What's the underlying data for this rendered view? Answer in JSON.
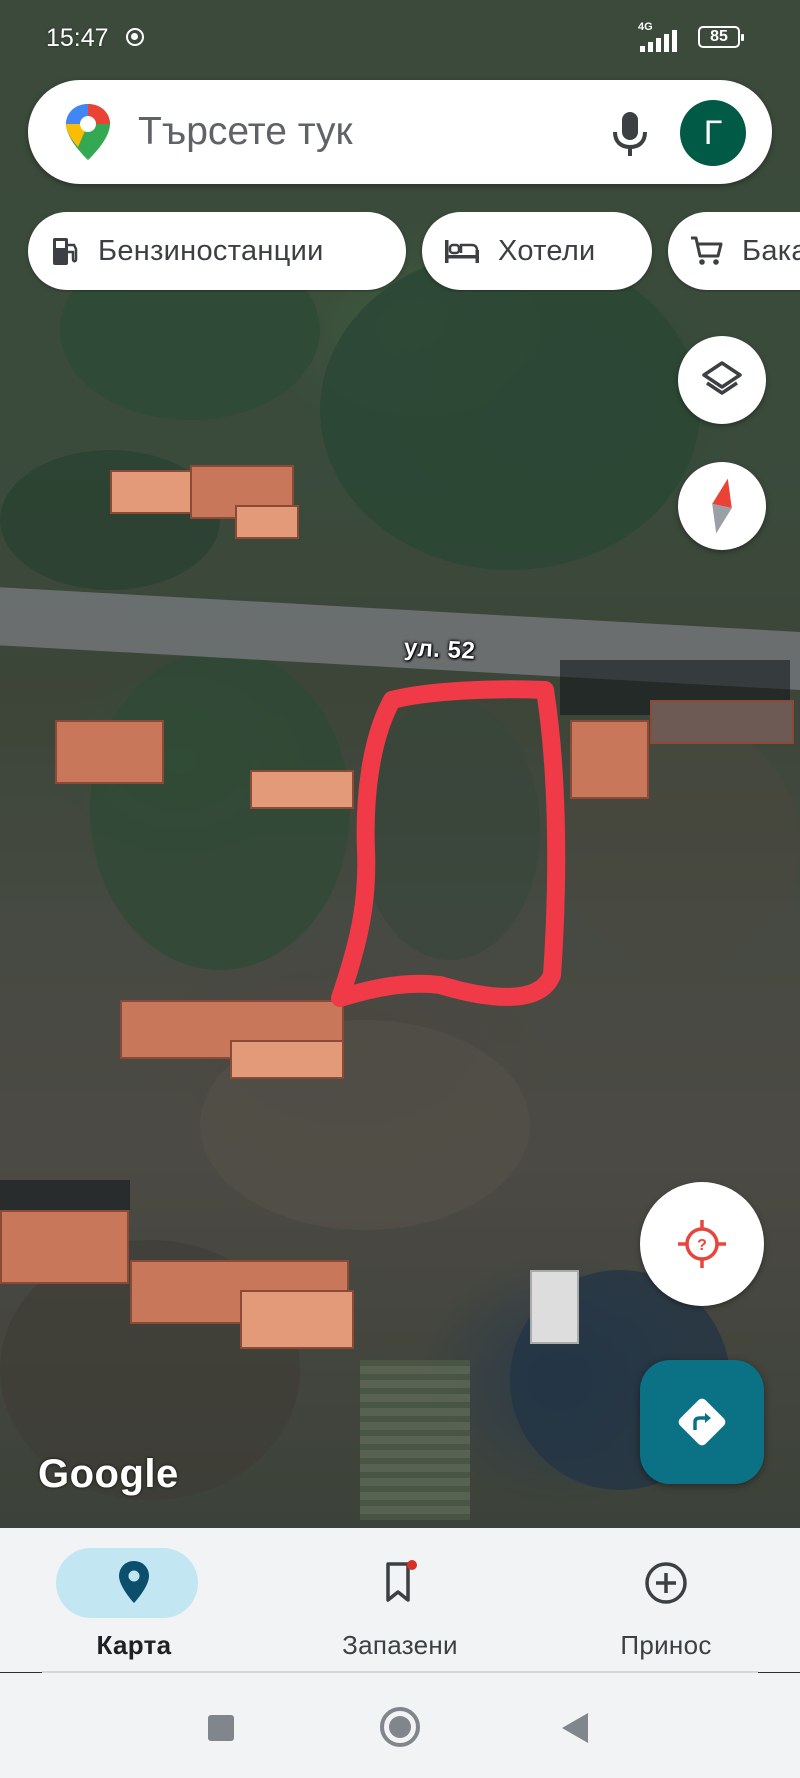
{
  "status_bar": {
    "time": "15:47",
    "network": "4G",
    "battery": "85"
  },
  "search": {
    "placeholder": "Търсете тук",
    "avatar_letter": "Г"
  },
  "chips": [
    {
      "label": "Бензиностанции",
      "icon": "gas-station-icon"
    },
    {
      "label": "Хотели",
      "icon": "hotel-bed-icon"
    },
    {
      "label": "Бакалии",
      "icon": "shopping-cart-icon"
    }
  ],
  "map": {
    "street_label": "ул. 52",
    "logo": "Google",
    "annotation_color": "#f03a47"
  },
  "bottom_nav": {
    "items": [
      {
        "label": "Карта",
        "icon": "map-pin-icon",
        "active": true
      },
      {
        "label": "Запазени",
        "icon": "bookmark-icon",
        "active": false,
        "badge": true
      },
      {
        "label": "Принос",
        "icon": "add-circle-icon",
        "active": false
      }
    ]
  },
  "colors": {
    "directions_button": "#0b7285",
    "active_tab_pill": "#c2e7f3",
    "avatar": "#005a46"
  }
}
